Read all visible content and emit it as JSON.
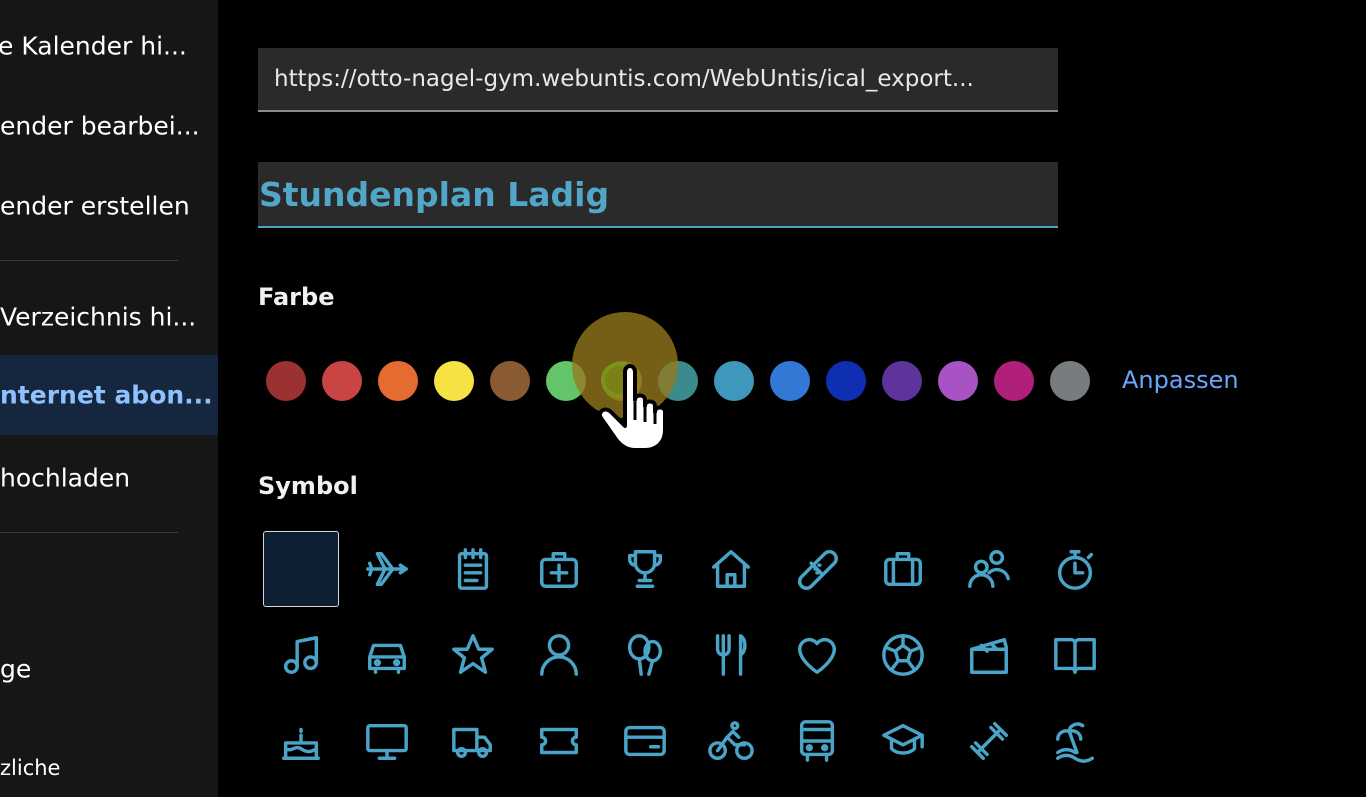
{
  "sidebar": {
    "items": [
      {
        "label": "e Kalender hi..."
      },
      {
        "label": "ender bearbei..."
      },
      {
        "label": "ender erstellen"
      },
      {
        "label": "Verzeichnis hi..."
      },
      {
        "label": "nternet abon..."
      },
      {
        "label": "hochladen"
      },
      {
        "label": "ge"
      },
      {
        "label": "zliche"
      }
    ]
  },
  "form": {
    "url_value": "https://otto-nagel-gym.webuntis.com/WebUntis/ical_export...",
    "name_value": "Stundenplan Ladig",
    "color_label": "Farbe",
    "customize_label": "Anpassen",
    "symbol_label": "Symbol"
  },
  "colors": [
    "#9b3130",
    "#c94543",
    "#e46c31",
    "#f6e245",
    "#8a5a32",
    "#63c46a",
    "#7a8c1c",
    "#3b8a8c",
    "#3f98bb",
    "#3378d4",
    "#0f2fb3",
    "#5e339b",
    "#a753c3",
    "#b01f79",
    "#777d7f"
  ],
  "icons": [
    [
      "none",
      "airplane-icon",
      "notepad-icon",
      "first-aid-icon",
      "trophy-icon",
      "home-icon",
      "bandage-icon",
      "briefcase-icon",
      "people-icon",
      "stopwatch-icon"
    ],
    [
      "music-note-icon",
      "car-icon",
      "star-icon",
      "person-icon",
      "balloons-icon",
      "fork-knife-icon",
      "heart-icon",
      "soccer-ball-icon",
      "clapperboard-icon",
      "book-icon"
    ],
    [
      "birthday-cake-icon",
      "monitor-icon",
      "truck-icon",
      "ticket-icon",
      "credit-card-icon",
      "bicycle-icon",
      "bus-icon",
      "graduation-cap-icon",
      "dumbbell-icon",
      "beach-icon"
    ]
  ]
}
